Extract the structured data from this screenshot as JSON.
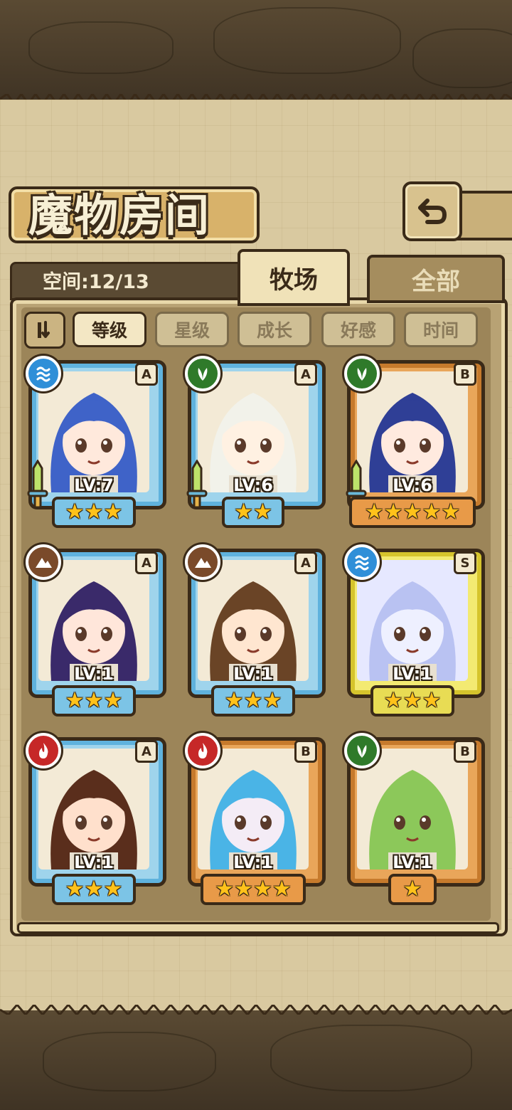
{
  "header": {
    "title": "魔物房间",
    "back_icon": "return-arrow-icon"
  },
  "capacity": {
    "label": "空间:12/13"
  },
  "tabs": [
    {
      "label": "牧场",
      "active": true
    },
    {
      "label": "全部",
      "active": false
    }
  ],
  "sort": {
    "toggle_icon": "sort-order-icon",
    "options": [
      {
        "label": "等级",
        "active": true
      },
      {
        "label": "星级",
        "active": false
      },
      {
        "label": "成长",
        "active": false
      },
      {
        "label": "好感",
        "active": false
      },
      {
        "label": "时间",
        "active": false
      }
    ]
  },
  "monsters": [
    {
      "level": "LV:7",
      "rank": "A",
      "element": "water",
      "stars": 3,
      "frame": "blue",
      "weapon": true,
      "hair": "#3f63c8",
      "skin": "#ffe9dc"
    },
    {
      "level": "LV:6",
      "rank": "A",
      "element": "grass",
      "stars": 2,
      "frame": "blue",
      "weapon": true,
      "hair": "#f2f2ea",
      "skin": "#fff1e2"
    },
    {
      "level": "LV:6",
      "rank": "B",
      "element": "grass",
      "stars": 5,
      "frame": "gold",
      "weapon": true,
      "hair": "#2f3f96",
      "skin": "#ffeadf"
    },
    {
      "level": "LV:1",
      "rank": "A",
      "element": "earth",
      "stars": 3,
      "frame": "blue",
      "weapon": false,
      "hair": "#3a2a6a",
      "skin": "#ffe6da"
    },
    {
      "level": "LV:1",
      "rank": "A",
      "element": "earth",
      "stars": 3,
      "frame": "blue",
      "weapon": false,
      "hair": "#6a4426",
      "skin": "#ffe6d0"
    },
    {
      "level": "LV:1",
      "rank": "S",
      "element": "water",
      "stars": 3,
      "frame": "yellow",
      "weapon": false,
      "hair": "#b9c2f2",
      "skin": "#eef0ff"
    },
    {
      "level": "LV:1",
      "rank": "A",
      "element": "fire",
      "stars": 3,
      "frame": "blue",
      "weapon": false,
      "hair": "#5a2e1c",
      "skin": "#ffe0cc"
    },
    {
      "level": "LV:1",
      "rank": "B",
      "element": "fire",
      "stars": 4,
      "frame": "gold",
      "weapon": false,
      "hair": "#4ab4e6",
      "skin": "#f4ecf6"
    },
    {
      "level": "LV:1",
      "rank": "B",
      "element": "grass",
      "stars": 1,
      "frame": "gold",
      "weapon": false,
      "hair": "#8cc85a",
      "skin": "#8cc85a"
    }
  ]
}
